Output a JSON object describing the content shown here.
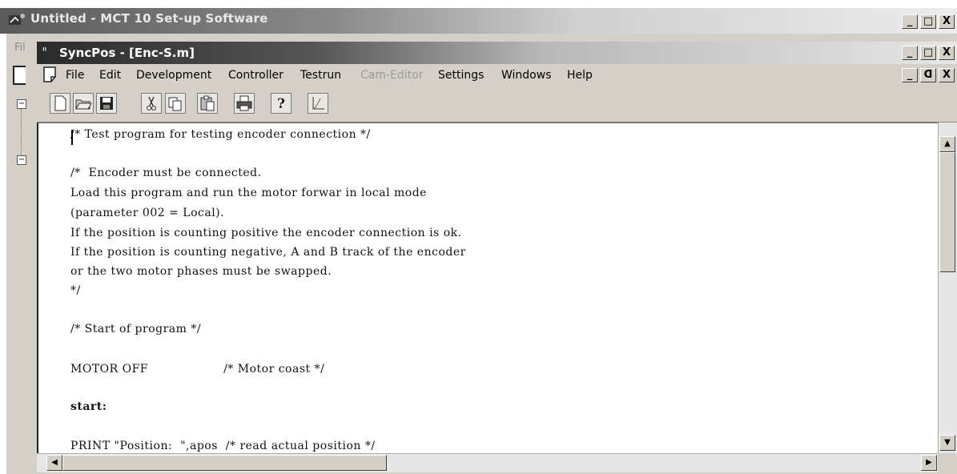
{
  "outer_window": {
    "title": "Untitled - MCT 10 Set-up Software",
    "menu_stub": "Fil",
    "controls": {
      "minimize": "_",
      "maximize": "□",
      "close": "X"
    }
  },
  "inner_window": {
    "title": "SyncPos - [Enc-S.m]",
    "icon_text": "ᴵᴵ",
    "controls": {
      "minimize": "_",
      "maximize": "□",
      "close": "X"
    },
    "doc_controls": {
      "minimize": "_",
      "restore": "ᗡ",
      "close": "X"
    }
  },
  "menu": {
    "items": [
      "File",
      "Edit",
      "Development",
      "Controller",
      "Testrun",
      "Cam-Editor",
      "Settings",
      "Windows",
      "Help"
    ],
    "disabled": [
      "Cam-Editor"
    ]
  },
  "toolbar": {
    "buttons": [
      "new-icon",
      "open-icon",
      "save-icon",
      "cut-icon",
      "copy-icon",
      "paste-icon",
      "print-icon",
      "help-icon",
      "chart-icon"
    ]
  },
  "tree": {
    "expander_1": "−",
    "expander_2": "−"
  },
  "editor": {
    "lines": [
      "/* Test program for testing encoder connection */",
      "",
      "/*  Encoder must be connected.",
      "Load this program and run the motor forwar in local mode",
      "(parameter 002 = Local).",
      "If the position is counting positive the encoder connection is ok.",
      "If the position is counting negative, A and B track of the encoder",
      "or the two motor phases must be swapped.",
      "*/",
      "",
      "/* Start of program */",
      "",
      "MOTOR OFF                   /* Motor coast */",
      "",
      "start:",
      "",
      "PRINT \"Position:  \",apos  /* read actual position */"
    ]
  },
  "scroll": {
    "up": "▲",
    "down": "▼",
    "left": "◀",
    "right": "▶"
  },
  "colors": {
    "face": "#d4d0c8",
    "editor_bg": "#ffffff",
    "title_dark": "#2a2a2a"
  }
}
